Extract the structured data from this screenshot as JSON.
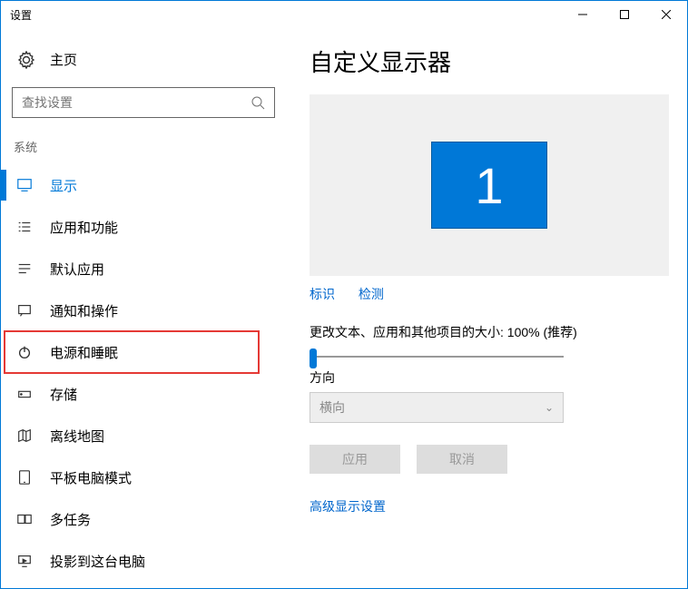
{
  "window": {
    "title": "设置"
  },
  "sidebar": {
    "home": "主页",
    "search_placeholder": "查找设置",
    "section": "系统",
    "items": [
      {
        "label": "显示"
      },
      {
        "label": "应用和功能"
      },
      {
        "label": "默认应用"
      },
      {
        "label": "通知和操作"
      },
      {
        "label": "电源和睡眠"
      },
      {
        "label": "存储"
      },
      {
        "label": "离线地图"
      },
      {
        "label": "平板电脑模式"
      },
      {
        "label": "多任务"
      },
      {
        "label": "投影到这台电脑"
      }
    ]
  },
  "main": {
    "heading": "自定义显示器",
    "monitor_number": "1",
    "identify": "标识",
    "detect": "检测",
    "scale_label": "更改文本、应用和其他项目的大小: 100% (推荐)",
    "orientation_label": "方向",
    "orientation_value": "横向",
    "apply": "应用",
    "cancel": "取消",
    "advanced": "高级显示设置"
  }
}
